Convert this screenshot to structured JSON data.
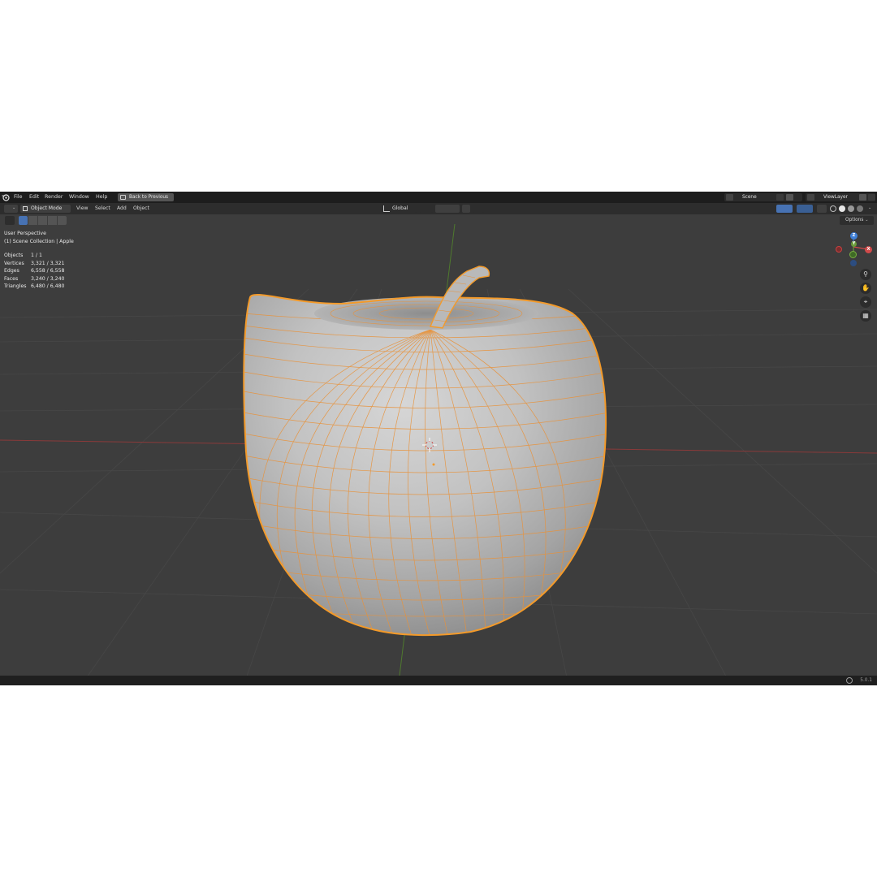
{
  "menubar": {
    "items": [
      "File",
      "Edit",
      "Render",
      "Window",
      "Help"
    ],
    "back_button": "Back to Previous",
    "scene": "Scene",
    "view_layer": "ViewLayer"
  },
  "header": {
    "mode": "Object Mode",
    "menus": [
      "View",
      "Select",
      "Add",
      "Object"
    ],
    "transform_orientation": "Global"
  },
  "options_label": "Options",
  "viewport": {
    "view_name": "User Perspective",
    "collection_path": "(1) Scene Collection | Apple",
    "stats": [
      {
        "label": "Objects",
        "value": "1 / 1"
      },
      {
        "label": "Vertices",
        "value": "3,321 / 3,321"
      },
      {
        "label": "Edges",
        "value": "6,558 / 6,558"
      },
      {
        "label": "Faces",
        "value": "3,240 / 3,240"
      },
      {
        "label": "Triangles",
        "value": "6,480 / 6,480"
      }
    ]
  },
  "gizmo": {
    "z": "Z",
    "y": "Y",
    "x": "X"
  },
  "colors": {
    "selection_outline": "#f39a2a",
    "wire": "#e8923a",
    "axis_x": "#d04a4a",
    "axis_y": "#6a9c3a",
    "axis_z": "#3f7fd6"
  },
  "status": {
    "version": "5.0.1"
  }
}
